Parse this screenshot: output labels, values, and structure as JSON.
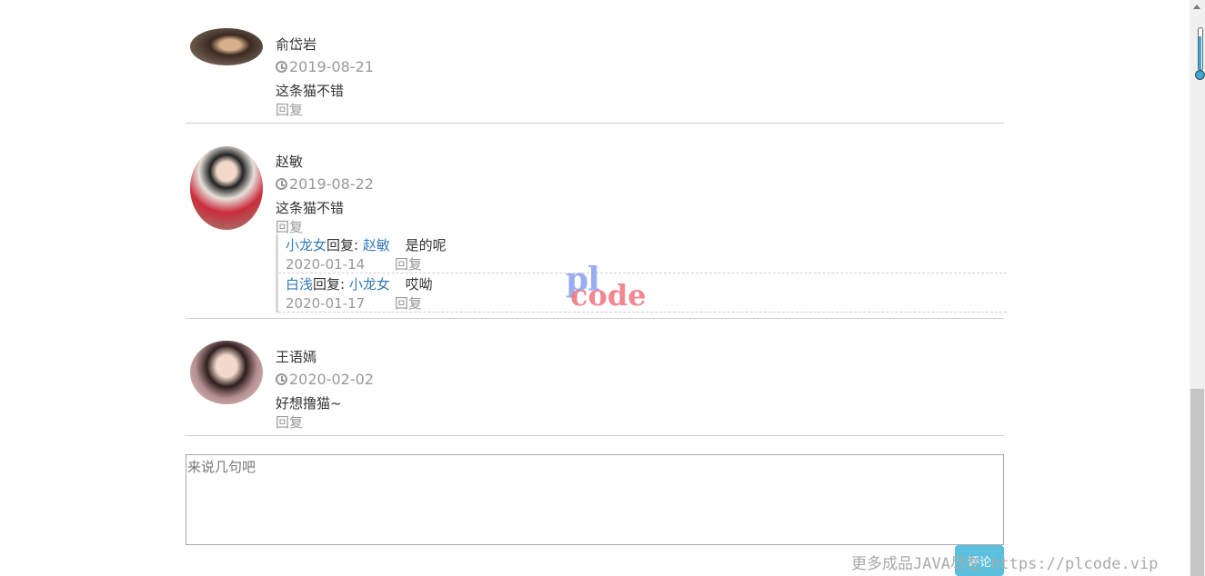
{
  "comments": [
    {
      "name": "俞岱岩",
      "date": "2019-08-21",
      "text": "这条猫不错",
      "reply_label": "回复",
      "replies": []
    },
    {
      "name": "赵敏",
      "date": "2019-08-22",
      "text": "这条猫不错",
      "reply_label": "回复",
      "replies": [
        {
          "from": "小龙女",
          "reply_word": "回复:",
          "to": "赵敏",
          "content": "是的呢",
          "date": "2020-01-14",
          "reply_label": "回复"
        },
        {
          "from": "白浅",
          "reply_word": "回复:",
          "to": "小龙女",
          "content": "哎呦",
          "date": "2020-01-17",
          "reply_label": "回复"
        }
      ]
    },
    {
      "name": "王语嫣",
      "date": "2020-02-02",
      "text": "好想撸猫~",
      "reply_label": "回复",
      "replies": []
    }
  ],
  "comment_box": {
    "placeholder": "来说几句吧"
  },
  "submit_label": "评论",
  "watermark": {
    "top": "pl",
    "bottom": "code"
  },
  "footer_text": "更多成品JAVA尽在 https://plcode.vip",
  "colors": {
    "link": "#337ab7",
    "button": "#5bc0de",
    "muted": "#999999"
  },
  "icons": {
    "date": "clock-icon",
    "scroll": "scrollbar",
    "thermometer": "thermometer-icon"
  },
  "scroll": {
    "position_fraction": 1.0
  }
}
